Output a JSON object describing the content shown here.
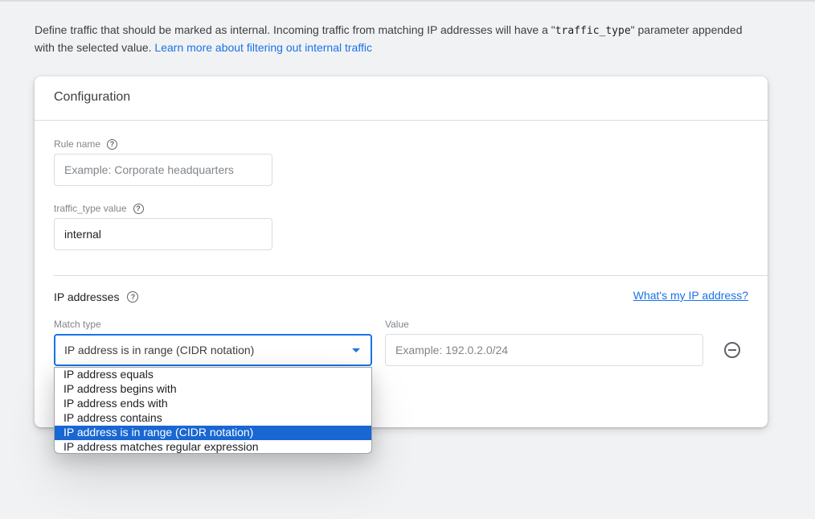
{
  "intro": {
    "text_before_code": "Define traffic that should be marked as internal. Incoming traffic from matching IP addresses will have a \"",
    "code": "traffic_type",
    "text_after_code": "\" parameter appended with the selected value. ",
    "learn_more_link": "Learn more about filtering out internal traffic"
  },
  "card": {
    "title": "Configuration",
    "rule_name": {
      "label": "Rule name",
      "help_icon": "help-circle-icon",
      "value": "",
      "placeholder": "Example: Corporate headquarters"
    },
    "traffic_type": {
      "label": "traffic_type value",
      "help_icon": "help-circle-icon",
      "value": "internal",
      "placeholder": ""
    },
    "ip_addresses": {
      "title": "IP addresses",
      "help_icon": "help-circle-icon",
      "whats_my_ip_link": "What's my IP address?",
      "match_type": {
        "label": "Match type",
        "selected": "IP address is in range (CIDR notation)",
        "options": [
          "IP address equals",
          "IP address begins with",
          "IP address ends with",
          "IP address contains",
          "IP address is in range (CIDR notation)",
          "IP address matches regular expression"
        ],
        "selected_index": 4
      },
      "value": {
        "label": "Value",
        "value": "",
        "placeholder": "Example: 192.0.2.0/24"
      },
      "remove_icon": "remove-circle-icon"
    }
  },
  "colors": {
    "accent": "#1a73e8",
    "selected_option_bg": "#1967d2",
    "page_bg": "#f1f2f4"
  }
}
